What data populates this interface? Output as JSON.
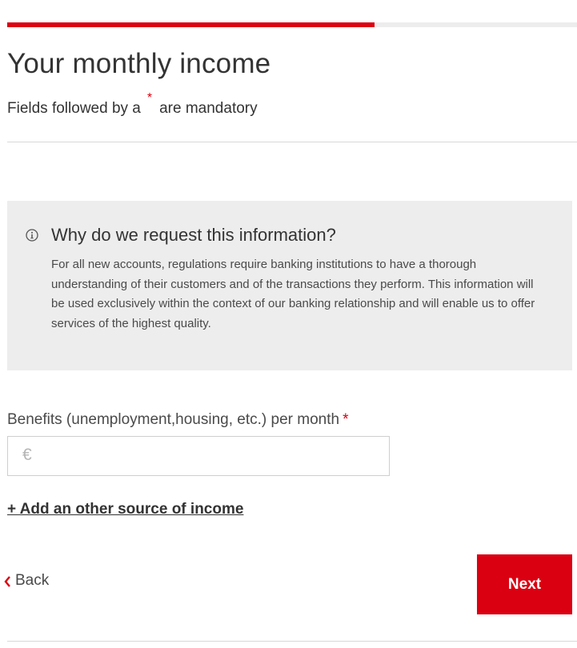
{
  "progress": {
    "fraction": 0.645
  },
  "header": {
    "title": "Your monthly income",
    "mandatory_prefix": "Fields followed by a",
    "mandatory_star": "*",
    "mandatory_suffix": "are mandatory"
  },
  "info": {
    "icon": "info-icon",
    "heading": "Why do we request this information?",
    "text": "For all new accounts, regulations require banking institutions to have a thorough understanding of their customers and of the transactions they perform. This information will be used exclusively within the context of our banking relationship and will enable us to offer services of the highest quality."
  },
  "form": {
    "benefits_label": "Benefits (unemployment,housing, etc.) per month",
    "required_star": "*",
    "currency_symbol": "€",
    "benefits_value": "",
    "add_income_link": "+ Add an other source of income"
  },
  "nav": {
    "back_label": "Back",
    "next_label": "Next"
  },
  "colors": {
    "accent": "#db0011",
    "info_background": "#ededed",
    "text": "#333333"
  }
}
